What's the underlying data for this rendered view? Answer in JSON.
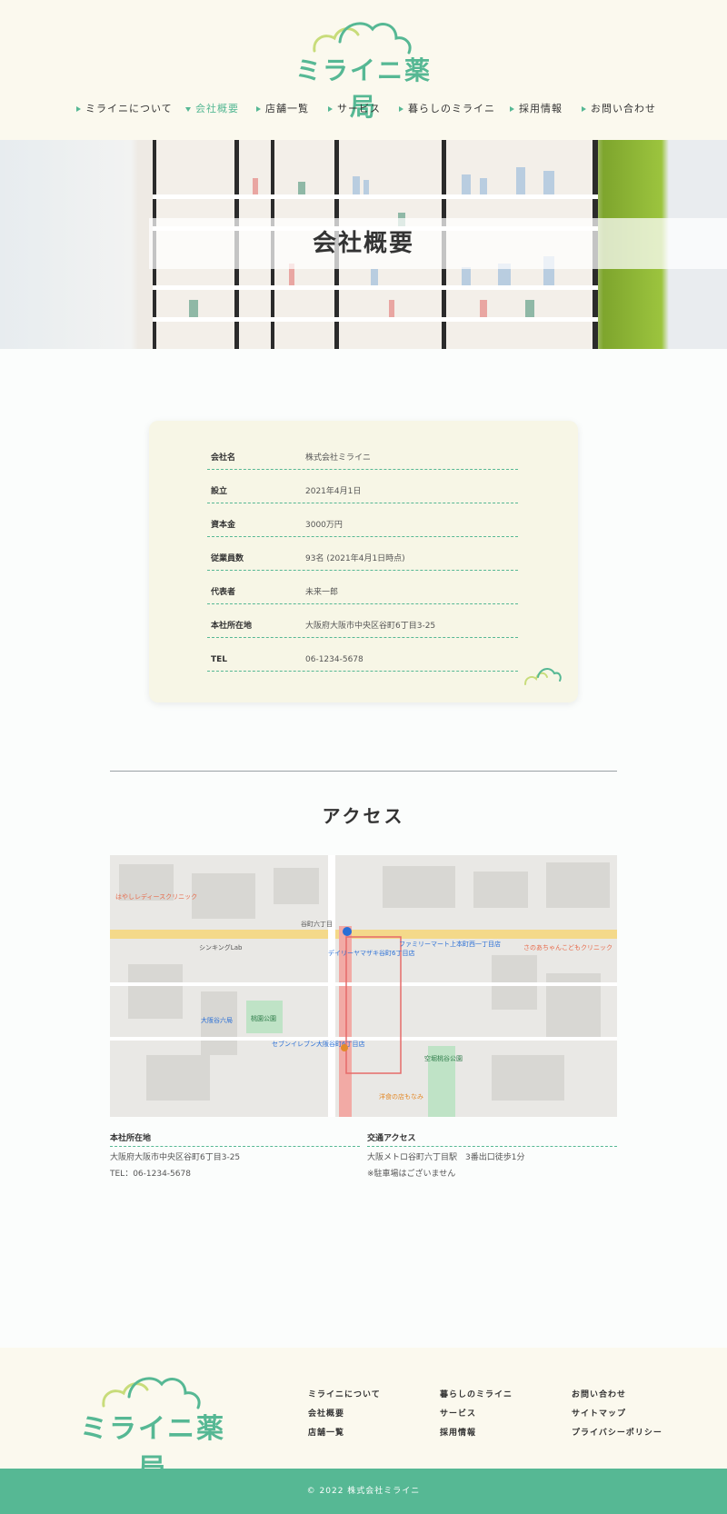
{
  "brand": {
    "name": "ミライニ薬局",
    "accent": "#56b894",
    "cloud_color": "#c8dc7a"
  },
  "nav": [
    {
      "label": "ミライニについて"
    },
    {
      "label": "会社概要"
    },
    {
      "label": "店舗一覧"
    },
    {
      "label": "サービス"
    },
    {
      "label": "暮らしのミライニ"
    },
    {
      "label": "採用情報"
    },
    {
      "label": "お問い合わせ"
    }
  ],
  "nav_active": "会社概要",
  "hero": {
    "title": "会社概要"
  },
  "company": [
    {
      "label": "会社名",
      "value": "株式会社ミライニ"
    },
    {
      "label": "設立",
      "value": "2021年4月1日"
    },
    {
      "label": "資本金",
      "value": "3000万円"
    },
    {
      "label": "従業員数",
      "value": "93名 (2021年4月1日時点)"
    },
    {
      "label": "代表者",
      "value": "未来一郎"
    },
    {
      "label": "本社所在地",
      "value": "大阪府大阪市中央区谷町6丁目3-25"
    },
    {
      "label": "TEL",
      "value": "06-1234-5678"
    }
  ],
  "access": {
    "title": "アクセス",
    "map": {
      "labels": [
        {
          "text": "谷町六丁目"
        },
        {
          "text": "ファミリーマート上本町西一丁目店"
        },
        {
          "text": "デイリーヤマザキ谷町6丁目店"
        },
        {
          "text": "大阪谷六局"
        },
        {
          "text": "桃園公園"
        },
        {
          "text": "セブンイレブン大阪谷町6丁目店"
        },
        {
          "text": "空堀桃谷公園"
        },
        {
          "text": "さのあちゃんこどもクリニック"
        },
        {
          "text": "はやしレディースクリニック"
        },
        {
          "text": "シンキングLab"
        },
        {
          "text": "洋食の店もなみ"
        }
      ]
    },
    "address_heading": "本社所在地",
    "address_lines": [
      "大阪府大阪市中央区谷町6丁目3-25",
      "TEL：06-1234-5678"
    ],
    "transit_heading": "交通アクセス",
    "transit_lines": [
      "大阪メトロ谷町六丁目駅　3番出口徒歩1分",
      "※駐車場はございません"
    ]
  },
  "footer": {
    "links": [
      {
        "label": "ミライニについて"
      },
      {
        "label": "暮らしのミライニ"
      },
      {
        "label": "お問い合わせ"
      },
      {
        "label": "会社概要"
      },
      {
        "label": "サービス"
      },
      {
        "label": "サイトマップ"
      },
      {
        "label": "店舗一覧"
      },
      {
        "label": "採用情報"
      },
      {
        "label": "プライバシーポリシー"
      }
    ],
    "copyright": "© 2022 株式会社ミライニ"
  }
}
